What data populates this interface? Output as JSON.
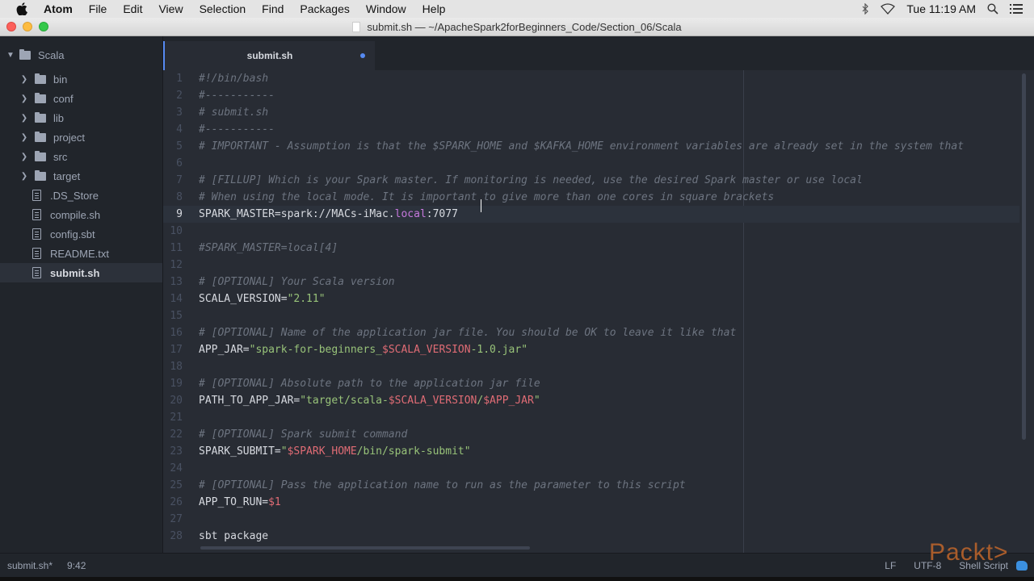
{
  "menubar": {
    "app_name": "Atom",
    "items": [
      "File",
      "Edit",
      "View",
      "Selection",
      "Find",
      "Packages",
      "Window",
      "Help"
    ],
    "clock": "Tue 11:19 AM",
    "icons": [
      "bluetooth-icon",
      "wifi-icon",
      "spotlight-search-icon",
      "notification-list-icon"
    ]
  },
  "window": {
    "title": "submit.sh — ~/ApacheSpark2forBeginners_Code/Section_06/Scala"
  },
  "tree": {
    "root": "Scala",
    "folders": [
      "bin",
      "conf",
      "lib",
      "project",
      "src",
      "target"
    ],
    "files": [
      ".DS_Store",
      "compile.sh",
      "config.sbt",
      "README.txt",
      "submit.sh"
    ],
    "selected": "submit.sh"
  },
  "tabs": [
    {
      "label": "submit.sh",
      "modified": true,
      "active": true
    }
  ],
  "editor": {
    "cursor_line": 9,
    "lines": [
      {
        "n": "1",
        "segs": [
          {
            "t": "#!/bin/bash",
            "c": "c"
          }
        ]
      },
      {
        "n": "2",
        "segs": [
          {
            "t": "#-----------",
            "c": "c"
          }
        ]
      },
      {
        "n": "3",
        "segs": [
          {
            "t": "# submit.sh",
            "c": "c"
          }
        ]
      },
      {
        "n": "4",
        "segs": [
          {
            "t": "#-----------",
            "c": "c"
          }
        ]
      },
      {
        "n": "5",
        "segs": [
          {
            "t": "# IMPORTANT - Assumption is that the $SPARK_HOME and $KAFKA_HOME environment variables are already set in the system that",
            "c": "c"
          }
        ]
      },
      {
        "n": "6",
        "segs": []
      },
      {
        "n": "7",
        "segs": [
          {
            "t": "# [FILLUP] Which is your Spark master. If monitoring is needed, use the desired Spark master or use local",
            "c": "c"
          }
        ]
      },
      {
        "n": "8",
        "segs": [
          {
            "t": "# When using the local mode. It is important to give more than one cores in square brackets",
            "c": "c"
          }
        ]
      },
      {
        "n": "9",
        "segs": [
          {
            "t": "SPARK_MASTER=spark://MACs-iMac.",
            "c": ""
          },
          {
            "t": "local",
            "c": "k"
          },
          {
            "t": ":7077",
            "c": ""
          }
        ]
      },
      {
        "n": "10",
        "segs": []
      },
      {
        "n": "11",
        "segs": [
          {
            "t": "#SPARK_MASTER=local[4]",
            "c": "c"
          }
        ]
      },
      {
        "n": "12",
        "segs": []
      },
      {
        "n": "13",
        "segs": [
          {
            "t": "# [OPTIONAL] Your Scala version",
            "c": "c"
          }
        ]
      },
      {
        "n": "14",
        "segs": [
          {
            "t": "SCALA_VERSION=",
            "c": ""
          },
          {
            "t": "\"2.11\"",
            "c": "s"
          }
        ]
      },
      {
        "n": "15",
        "segs": []
      },
      {
        "n": "16",
        "segs": [
          {
            "t": "# [OPTIONAL] Name of the application jar file. You should be OK to leave it like that",
            "c": "c"
          }
        ]
      },
      {
        "n": "17",
        "segs": [
          {
            "t": "APP_JAR=",
            "c": ""
          },
          {
            "t": "\"spark-for-beginners_",
            "c": "s"
          },
          {
            "t": "$SCALA_VERSION",
            "c": "v"
          },
          {
            "t": "-1.0.jar\"",
            "c": "s"
          }
        ]
      },
      {
        "n": "18",
        "segs": []
      },
      {
        "n": "19",
        "segs": [
          {
            "t": "# [OPTIONAL] Absolute path to the application jar file",
            "c": "c"
          }
        ]
      },
      {
        "n": "20",
        "segs": [
          {
            "t": "PATH_TO_APP_JAR=",
            "c": ""
          },
          {
            "t": "\"target/scala-",
            "c": "s"
          },
          {
            "t": "$SCALA_VERSION",
            "c": "v"
          },
          {
            "t": "/",
            "c": "s"
          },
          {
            "t": "$APP_JAR",
            "c": "v"
          },
          {
            "t": "\"",
            "c": "s"
          }
        ]
      },
      {
        "n": "21",
        "segs": []
      },
      {
        "n": "22",
        "segs": [
          {
            "t": "# [OPTIONAL] Spark submit command",
            "c": "c"
          }
        ]
      },
      {
        "n": "23",
        "segs": [
          {
            "t": "SPARK_SUBMIT=",
            "c": ""
          },
          {
            "t": "\"",
            "c": "s"
          },
          {
            "t": "$SPARK_HOME",
            "c": "v"
          },
          {
            "t": "/bin/spark-submit\"",
            "c": "s"
          }
        ]
      },
      {
        "n": "24",
        "segs": []
      },
      {
        "n": "25",
        "segs": [
          {
            "t": "# [OPTIONAL] Pass the application name to run as the parameter to this script",
            "c": "c"
          }
        ]
      },
      {
        "n": "26",
        "segs": [
          {
            "t": "APP_TO_RUN=",
            "c": ""
          },
          {
            "t": "$1",
            "c": "v"
          }
        ]
      },
      {
        "n": "27",
        "segs": []
      },
      {
        "n": "28",
        "segs": [
          {
            "t": "sbt package",
            "c": ""
          }
        ]
      }
    ]
  },
  "statusbar": {
    "file": "submit.sh*",
    "cursor": "9:42",
    "line_ending": "LF",
    "encoding": "UTF-8",
    "grammar": "Shell Script"
  },
  "watermark": "Packt>",
  "colors": {
    "accent": "#568af2",
    "string": "#98c379",
    "variable": "#e06c75",
    "keyword": "#c678dd",
    "comment": "#6d7480"
  }
}
